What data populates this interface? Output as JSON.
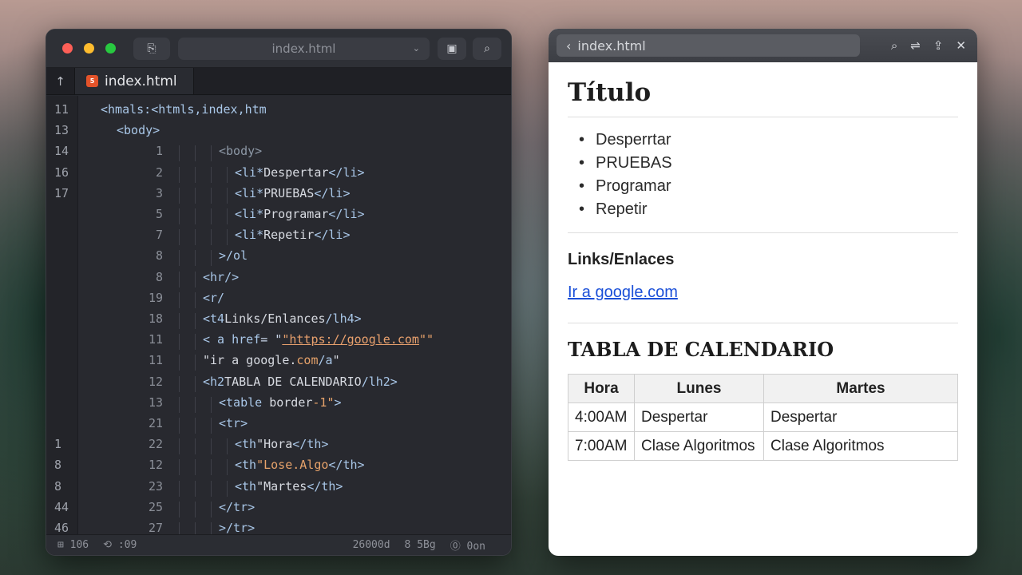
{
  "editor": {
    "address": "index.html",
    "tab_label": "index.html",
    "status": [
      "⊞ 106",
      "⟲ :09",
      "26000d",
      "8 5Bg",
      "⓪ 0on"
    ],
    "lines": [
      {
        "n": "11",
        "n2": "",
        "indent": 0,
        "html": "<span class='tag'>&lt;hmals:&lt;htmls,index,htm</span>"
      },
      {
        "n": "13",
        "n2": "",
        "indent": 1,
        "html": "<span class='tag'>&lt;body&gt;</span>"
      },
      {
        "n": "14",
        "n2": "1",
        "indent": 3,
        "html": "<span class='muted'>&lt;body&gt;</span>"
      },
      {
        "n": "16",
        "n2": "2",
        "indent": 4,
        "html": "<span class='tag'>&lt;li*</span>Despertar<span class='tag'>&lt;/li&gt;</span>"
      },
      {
        "n": "17",
        "n2": "3",
        "indent": 4,
        "html": "<span class='tag'>&lt;li*</span>PRUEBAS<span class='tag'>&lt;/li&gt;</span>"
      },
      {
        "n": "",
        "n2": "5",
        "indent": 4,
        "html": "<span class='tag'>&lt;li*</span>Programar<span class='tag'>&lt;/li&gt;</span>"
      },
      {
        "n": "",
        "n2": "7",
        "indent": 4,
        "html": "<span class='tag'>&lt;li*</span>Repetir<span class='tag'>&lt;/li&gt;</span>"
      },
      {
        "n": "",
        "n2": "8",
        "indent": 3,
        "html": "<span class='tag'>&gt;/ol</span>"
      },
      {
        "n": "",
        "n2": "8",
        "indent": 2,
        "html": "<span class='tag'>&lt;hr/&gt;</span>"
      },
      {
        "n": "",
        "n2": "19",
        "indent": 2,
        "html": "<span class='tag'>&lt;r/</span>"
      },
      {
        "n": "",
        "n2": "18",
        "indent": 2,
        "html": "<span class='tag'>&lt;t4</span>Links/Enlances<span class='tag'>/lh4&gt;</span>"
      },
      {
        "n": "",
        "n2": "11",
        "indent": 2,
        "html": "<span class='tag'>&lt; a href</span><span class='attr'>= \"</span><span class='link'>\"https://google.com</span><span class='str'>\"\"</span>"
      },
      {
        "n": "",
        "n2": "11",
        "indent": 2,
        "html": "\"ir a google.<span class='str'>com</span><span class='tag'>/a</span>\""
      },
      {
        "n": "",
        "n2": "12",
        "indent": 2,
        "html": "<span class='tag'>&lt;h2</span>TABLA DE CALENDARIO<span class='tag'>/lh2&gt;</span>"
      },
      {
        "n": "",
        "n2": "13",
        "indent": 3,
        "html": "<span class='tag'>&lt;table</span> border<span class='str'>-1\"</span><span class='tag'>&gt;</span>"
      },
      {
        "n": "",
        "n2": "21",
        "indent": 3,
        "html": "<span class='tag'>&lt;tr&gt;</span>"
      },
      {
        "n": "1",
        "n2": "22",
        "indent": 4,
        "html": "<span class='tag'>&lt;th</span>\"Hora<span class='tag'>&lt;/th&gt;</span>"
      },
      {
        "n": "8",
        "n2": "12",
        "indent": 4,
        "html": "<span class='tag'>&lt;th</span><span class='str'>\"Lose.Algo</span><span class='tag'>&lt;/th&gt;</span>"
      },
      {
        "n": "8",
        "n2": "23",
        "indent": 4,
        "html": "<span class='tag'>&lt;th</span>\"Martes<span class='tag'>&lt;/th&gt;</span>"
      },
      {
        "n": "44",
        "n2": "25",
        "indent": 3,
        "html": "<span class='tag'>&lt;/tr&gt;</span>"
      },
      {
        "n": "46",
        "n2": "27",
        "indent": 3,
        "html": "<span class='tag'>&gt;/tr&gt;</span>"
      }
    ]
  },
  "preview": {
    "address": "index.html",
    "title": "Título",
    "list": [
      "Desperrtar",
      "PRUEBAS",
      "Programar",
      "Repetir"
    ],
    "links_heading": "Links/Enlaces",
    "link_text": "Ir a google.com",
    "table_heading": "TABLA DE CALENDARIO",
    "table": {
      "headers": [
        "Hora",
        "Lunes",
        "Martes"
      ],
      "rows": [
        [
          "4:00AM",
          "Despertar",
          "Despertar"
        ],
        [
          "7:00AM",
          "Clase Algoritmos",
          "Clase Algoritmos"
        ]
      ]
    }
  }
}
